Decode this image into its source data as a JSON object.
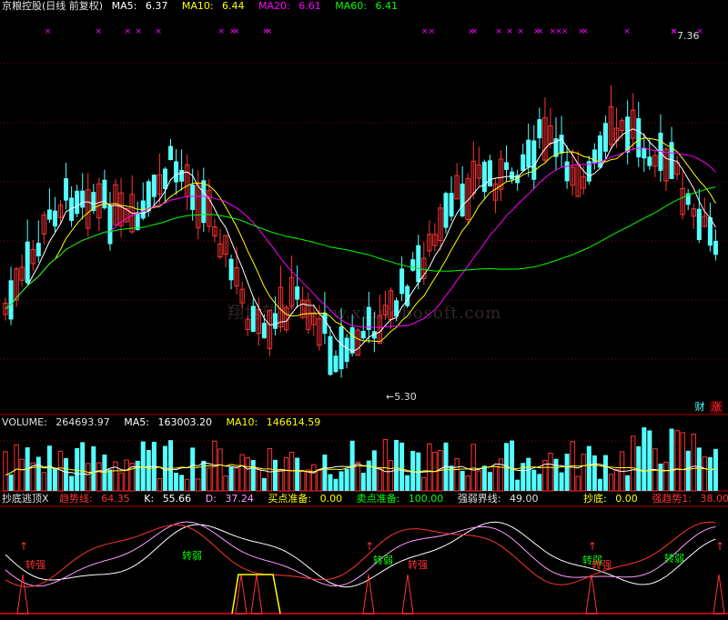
{
  "main": {
    "title": "京粮控股(日线 前复权)",
    "ma5_label": "MA5:",
    "ma5_value": "6.37",
    "ma10_label": "MA10:",
    "ma10_value": "6.44",
    "ma20_label": "MA20:",
    "ma20_value": "6.61",
    "ma60_label": "MA60:",
    "ma60_value": "6.41",
    "high_marker": "7.36",
    "low_marker": "5.30",
    "btn_cai": "财",
    "btn_zhang": "涨",
    "watermark": "翔博软件 www.xiangbosoft.com"
  },
  "volume": {
    "label": "VOLUME:",
    "value": "264693.97",
    "ma5_label": "MA5:",
    "ma5_value": "163003.20",
    "ma10_label": "MA10:",
    "ma10_value": "146614.59"
  },
  "indicator": {
    "name": "抄底逃顶X",
    "trend_label": "趋势线:",
    "trend_value": "64.35",
    "k_label": "K:",
    "k_value": "55.66",
    "d_label": "D:",
    "d_value": "37.24",
    "buy_label": "买点准备:",
    "buy_value": "0.00",
    "sell_label": "卖点准备:",
    "sell_value": "100.00",
    "line_label": "强弱界线:",
    "line_value": "49.00",
    "bottom_label": "抄底:",
    "bottom_value": "0.00",
    "strong_label": "强趋势1:",
    "strong_value": "38.00",
    "signal_strong": "转强",
    "signal_weak": "转弱"
  },
  "colors": {
    "up": "#ff3232",
    "down": "#54ffff",
    "ma5": "#ffffff",
    "ma10": "#ffff00",
    "ma20": "#ff00ff",
    "ma60": "#00ff00",
    "grid": "#800000",
    "axis": "#b00000"
  }
}
